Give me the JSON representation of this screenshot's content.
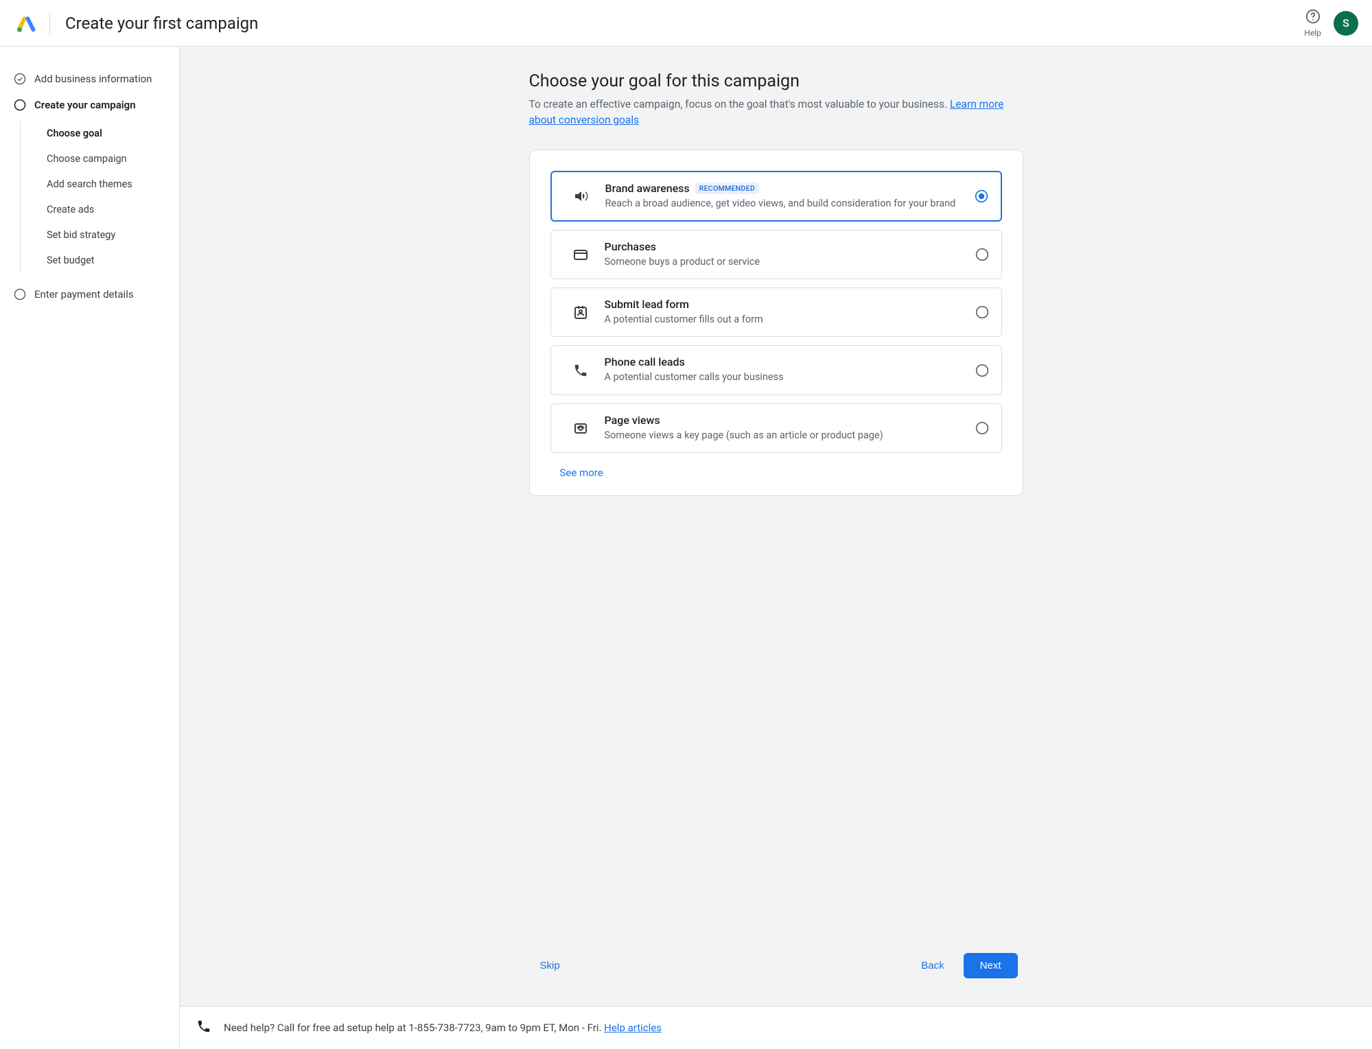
{
  "header": {
    "title": "Create your first campaign",
    "help_label": "Help",
    "avatar_letter": "S"
  },
  "sidebar": {
    "steps": [
      {
        "label": "Add business information",
        "status": "done"
      },
      {
        "label": "Create your campaign",
        "status": "current"
      },
      {
        "label": "Enter payment details",
        "status": "pending"
      }
    ],
    "substeps": [
      {
        "label": "Choose goal",
        "active": true
      },
      {
        "label": "Choose campaign",
        "active": false
      },
      {
        "label": "Add search themes",
        "active": false
      },
      {
        "label": "Create ads",
        "active": false
      },
      {
        "label": "Set bid strategy",
        "active": false
      },
      {
        "label": "Set budget",
        "active": false
      }
    ]
  },
  "main": {
    "title": "Choose your goal for this campaign",
    "subtitle_text": "To create an effective campaign, focus on the goal that's most valuable to your business. ",
    "subtitle_link": "Learn more about conversion goals",
    "goals": [
      {
        "title": "Brand awareness",
        "badge": "RECOMMENDED",
        "desc": "Reach a broad audience, get video views, and build consideration for your brand",
        "selected": true,
        "icon": "megaphone"
      },
      {
        "title": "Purchases",
        "desc": "Someone buys a product or service",
        "selected": false,
        "icon": "card"
      },
      {
        "title": "Submit lead form",
        "desc": "A potential customer fills out a form",
        "selected": false,
        "icon": "form"
      },
      {
        "title": "Phone call leads",
        "desc": "A potential customer calls your business",
        "selected": false,
        "icon": "phone"
      },
      {
        "title": "Page views",
        "desc": "Someone views a key page (such as an article or product page)",
        "selected": false,
        "icon": "eye"
      }
    ],
    "see_more": "See more",
    "buttons": {
      "skip": "Skip",
      "back": "Back",
      "next": "Next"
    }
  },
  "helpbar": {
    "text": "Need help? Call for free ad setup help at 1-855-738-7723, 9am to 9pm ET, Mon - Fri. ",
    "link": "Help articles"
  }
}
